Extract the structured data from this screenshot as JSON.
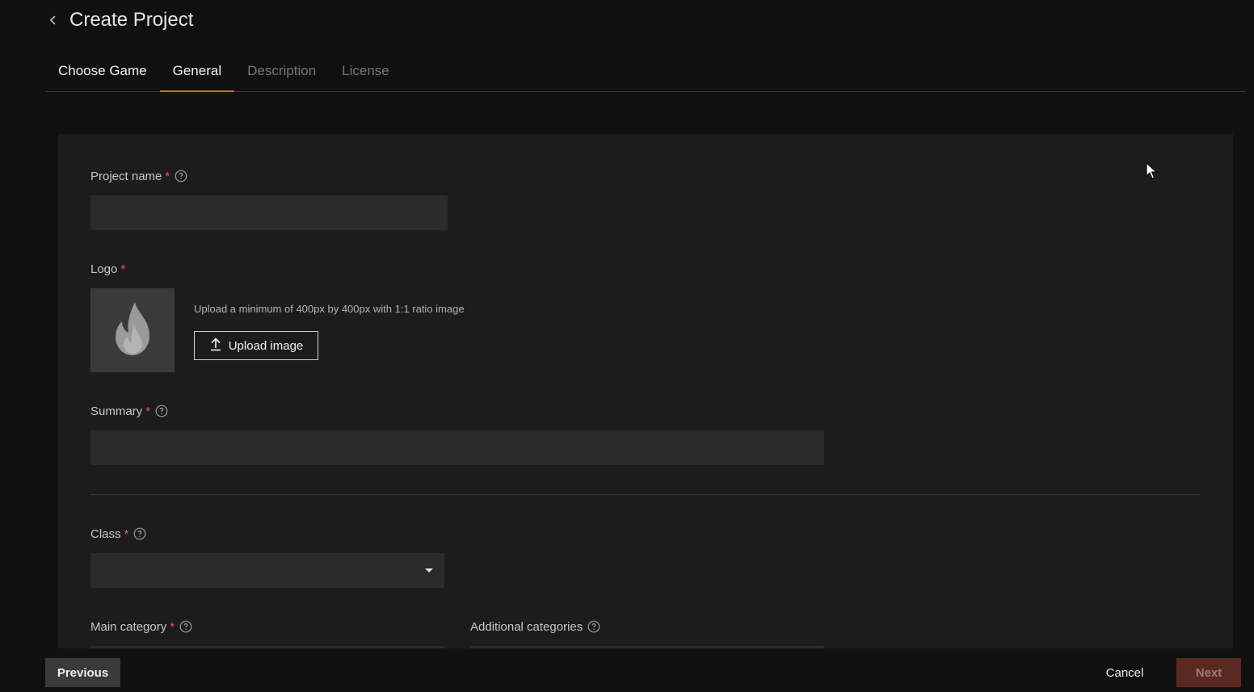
{
  "header": {
    "title": "Create Project"
  },
  "tabs": [
    {
      "label": "Choose Game",
      "state": "done"
    },
    {
      "label": "General",
      "state": "active"
    },
    {
      "label": "Description",
      "state": "pending"
    },
    {
      "label": "License",
      "state": "pending"
    }
  ],
  "form": {
    "project_name": {
      "label": "Project name",
      "required_mark": "*",
      "value": ""
    },
    "logo": {
      "label": "Logo",
      "required_mark": "*",
      "hint": "Upload a minimum of 400px by 400px with 1:1 ratio image",
      "upload_label": "Upload image",
      "placeholder_icon": "flame-icon"
    },
    "summary": {
      "label": "Summary",
      "required_mark": "*",
      "value": ""
    },
    "class": {
      "label": "Class",
      "required_mark": "*",
      "selected": ""
    },
    "main_category": {
      "label": "Main category",
      "required_mark": "*"
    },
    "additional_categories": {
      "label": "Additional categories"
    }
  },
  "footer": {
    "previous_label": "Previous",
    "cancel_label": "Cancel",
    "next_label": "Next"
  },
  "colors": {
    "accent": "#e0603f",
    "background": "#101010",
    "panel": "#1c1c1c",
    "input": "#2b2b2b",
    "next_disabled": "#5a2a22"
  }
}
